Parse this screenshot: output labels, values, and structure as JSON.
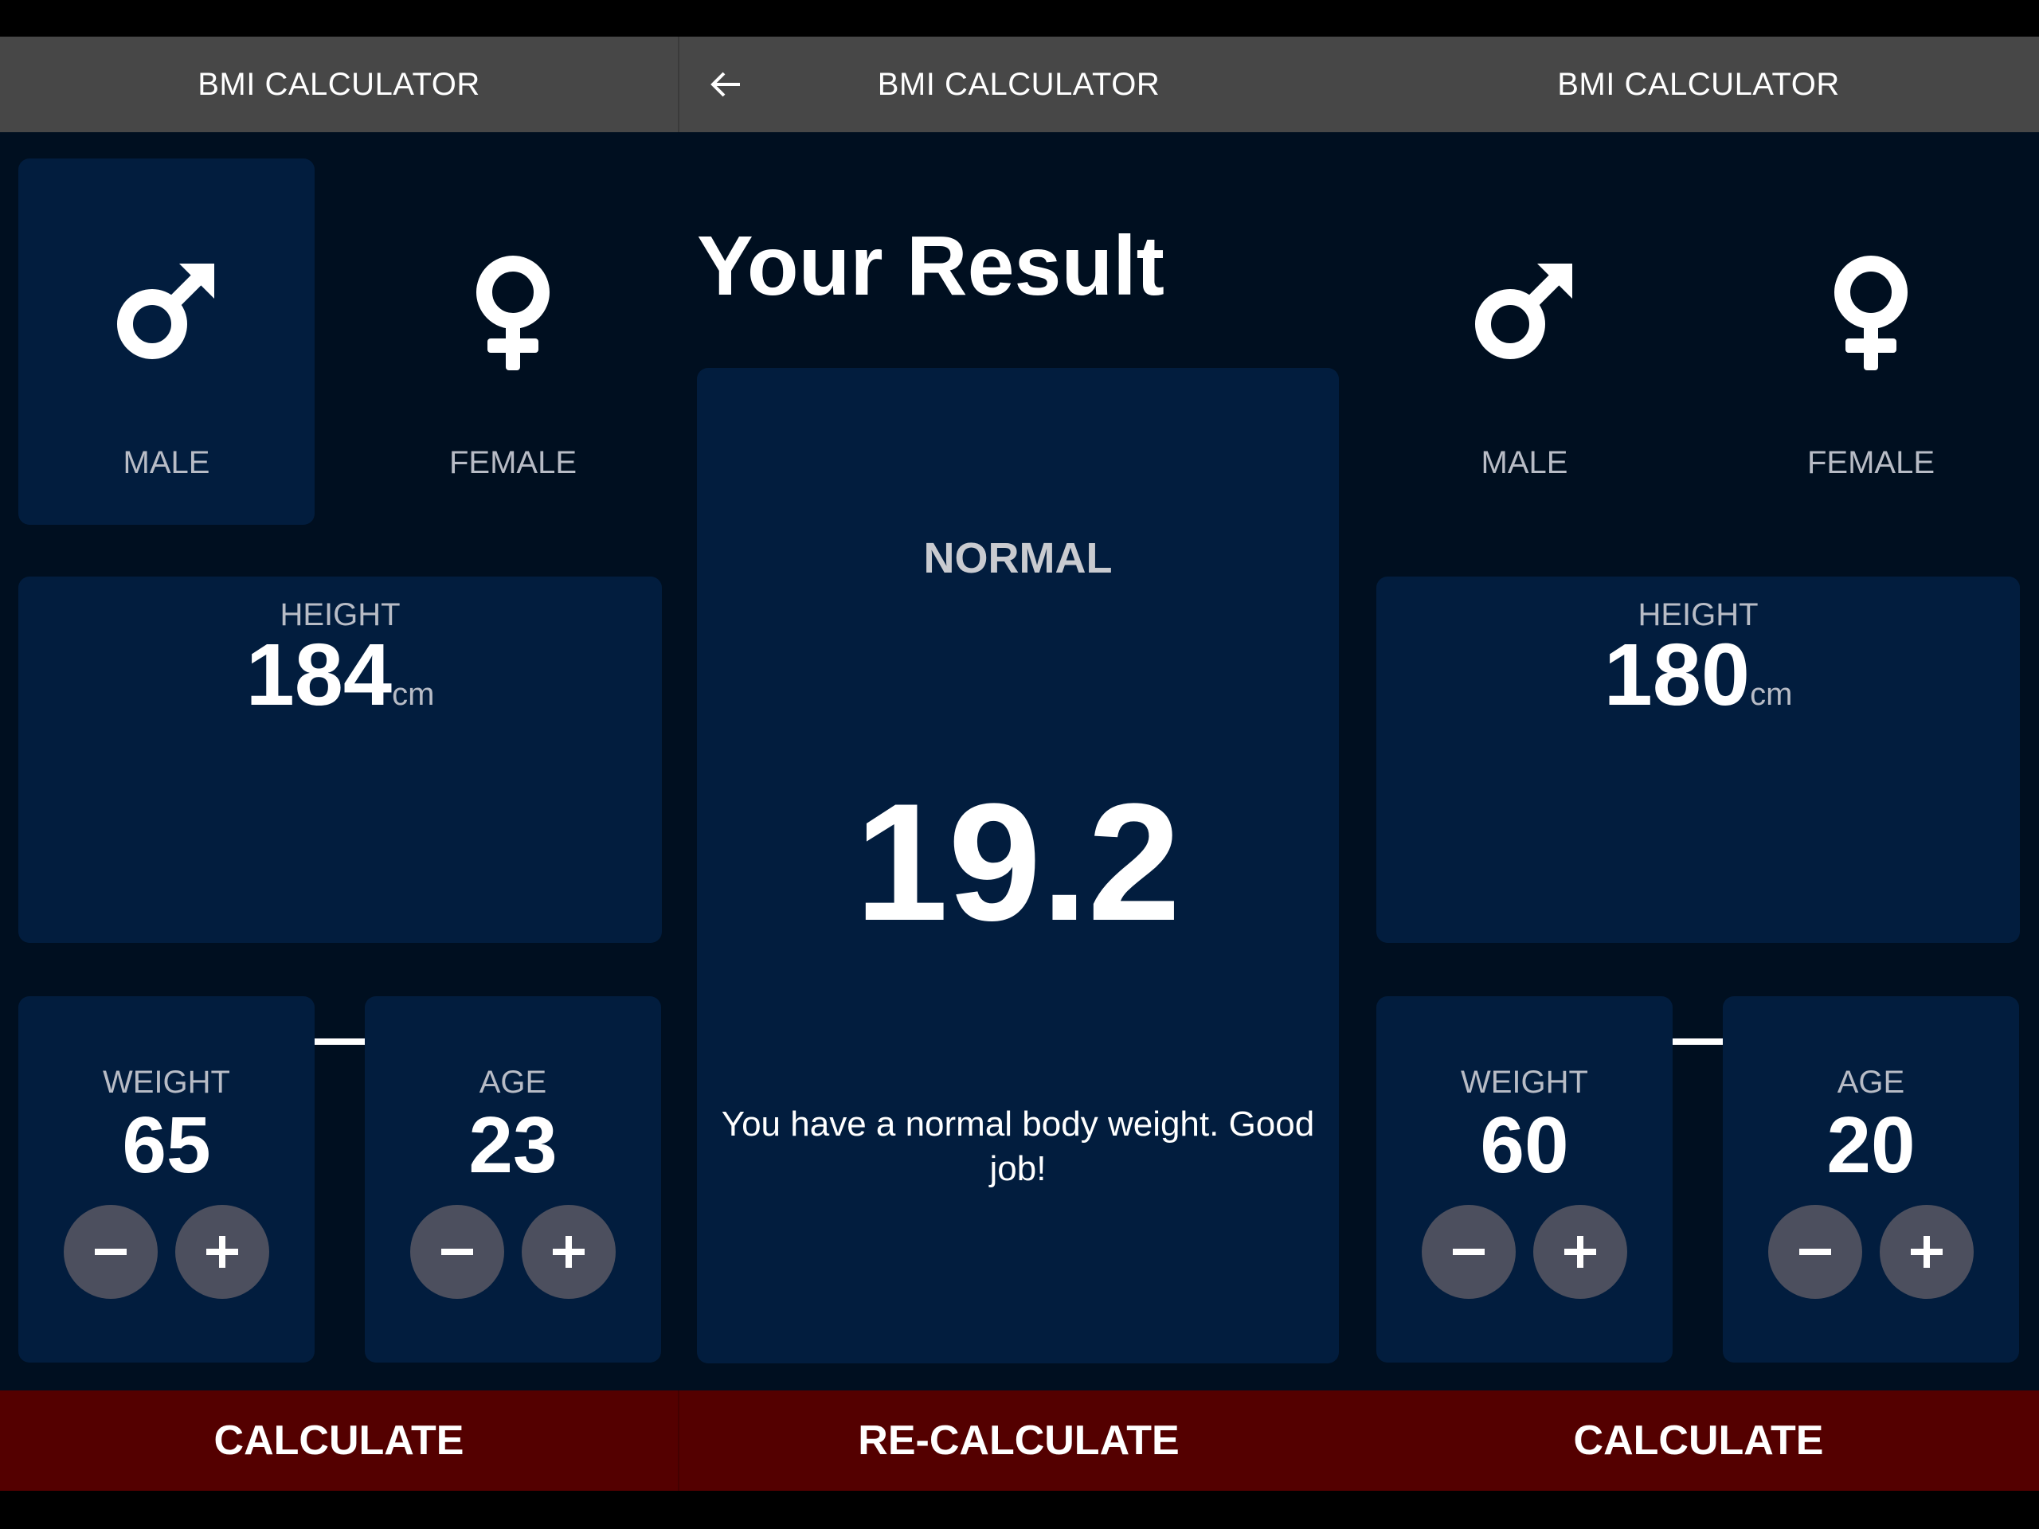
{
  "colors": {
    "background": "#000f20",
    "card": "#021d3e",
    "appbar": "#474747",
    "accent": "#540000",
    "thumb": "#5b0000",
    "round_button": "#4c4f5e"
  },
  "screen1": {
    "appbar_title": "BMI CALCULATOR",
    "gender": {
      "selected": "male",
      "male_icon": "male-symbol-icon",
      "male_label": "MALE",
      "female_icon": "female-symbol-icon",
      "female_label": "FEMALE"
    },
    "height": {
      "label": "HEIGHT",
      "value": "184",
      "unit": "cm",
      "slider_fraction": 0.64
    },
    "weight": {
      "label": "WEIGHT",
      "value": "65",
      "minus_icon": "minus-icon",
      "plus_icon": "plus-icon"
    },
    "age": {
      "label": "AGE",
      "value": "23",
      "minus_icon": "minus-icon",
      "plus_icon": "plus-icon"
    },
    "bottom_button": "CALCULATE"
  },
  "screen2": {
    "back_icon": "arrow-back-icon",
    "appbar_title": "BMI CALCULATOR",
    "result_title": "Your Result",
    "status": "NORMAL",
    "bmi": "19.2",
    "advice": "You have a normal body weight. Good job!",
    "bottom_button": "RE-CALCULATE"
  },
  "screen3": {
    "appbar_title": "BMI CALCULATOR",
    "gender": {
      "selected": "none",
      "male_icon": "male-symbol-icon",
      "male_label": "MALE",
      "female_icon": "female-symbol-icon",
      "female_label": "FEMALE"
    },
    "height": {
      "label": "HEIGHT",
      "value": "180",
      "unit": "cm",
      "slider_fraction": 0.6
    },
    "weight": {
      "label": "WEIGHT",
      "value": "60",
      "minus_icon": "minus-icon",
      "plus_icon": "plus-icon"
    },
    "age": {
      "label": "AGE",
      "value": "20",
      "minus_icon": "minus-icon",
      "plus_icon": "plus-icon"
    },
    "bottom_button": "CALCULATE"
  }
}
